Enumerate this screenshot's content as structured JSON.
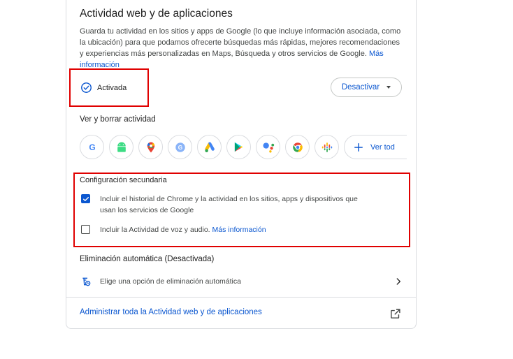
{
  "activity": {
    "title": "Actividad web y de aplicaciones",
    "description": "Guarda tu actividad en los sitios y apps de Google (lo que incluye información asociada, como la ubicación) para que podamos ofrecerte búsquedas más rápidas, mejores recomendaciones y experiencias más personalizadas en Maps, Búsqueda y otros servicios de Google.",
    "more_info_link": "Más información",
    "status": "Activada",
    "deactivate_button": "Desactivar"
  },
  "view_delete": {
    "label": "Ver y borrar actividad",
    "apps": [
      "google-icon",
      "android-icon",
      "maps-icon",
      "google-lens-icon",
      "google-ads-icon",
      "google-play-icon",
      "google-assistant-icon",
      "chrome-icon",
      "google-podcasts-icon"
    ],
    "see_all": "Ver tod"
  },
  "secondary": {
    "label": "Configuración secundaria",
    "chrome_history": {
      "text": "Incluir el historial de Chrome y la actividad en los sitios, apps y dispositivos que usan los servicios de Google",
      "checked": true
    },
    "voice_audio": {
      "text": "Incluir la Actividad de voz y audio.",
      "link": "Más información",
      "checked": false
    }
  },
  "auto_delete": {
    "label": "Eliminación automática (Desactivada)",
    "option": "Elige una opción de eliminación automática"
  },
  "manage_link": "Administrar toda la Actividad web y de aplicaciones",
  "colors": {
    "accent": "#0b57d0",
    "highlight": "#e00000"
  }
}
